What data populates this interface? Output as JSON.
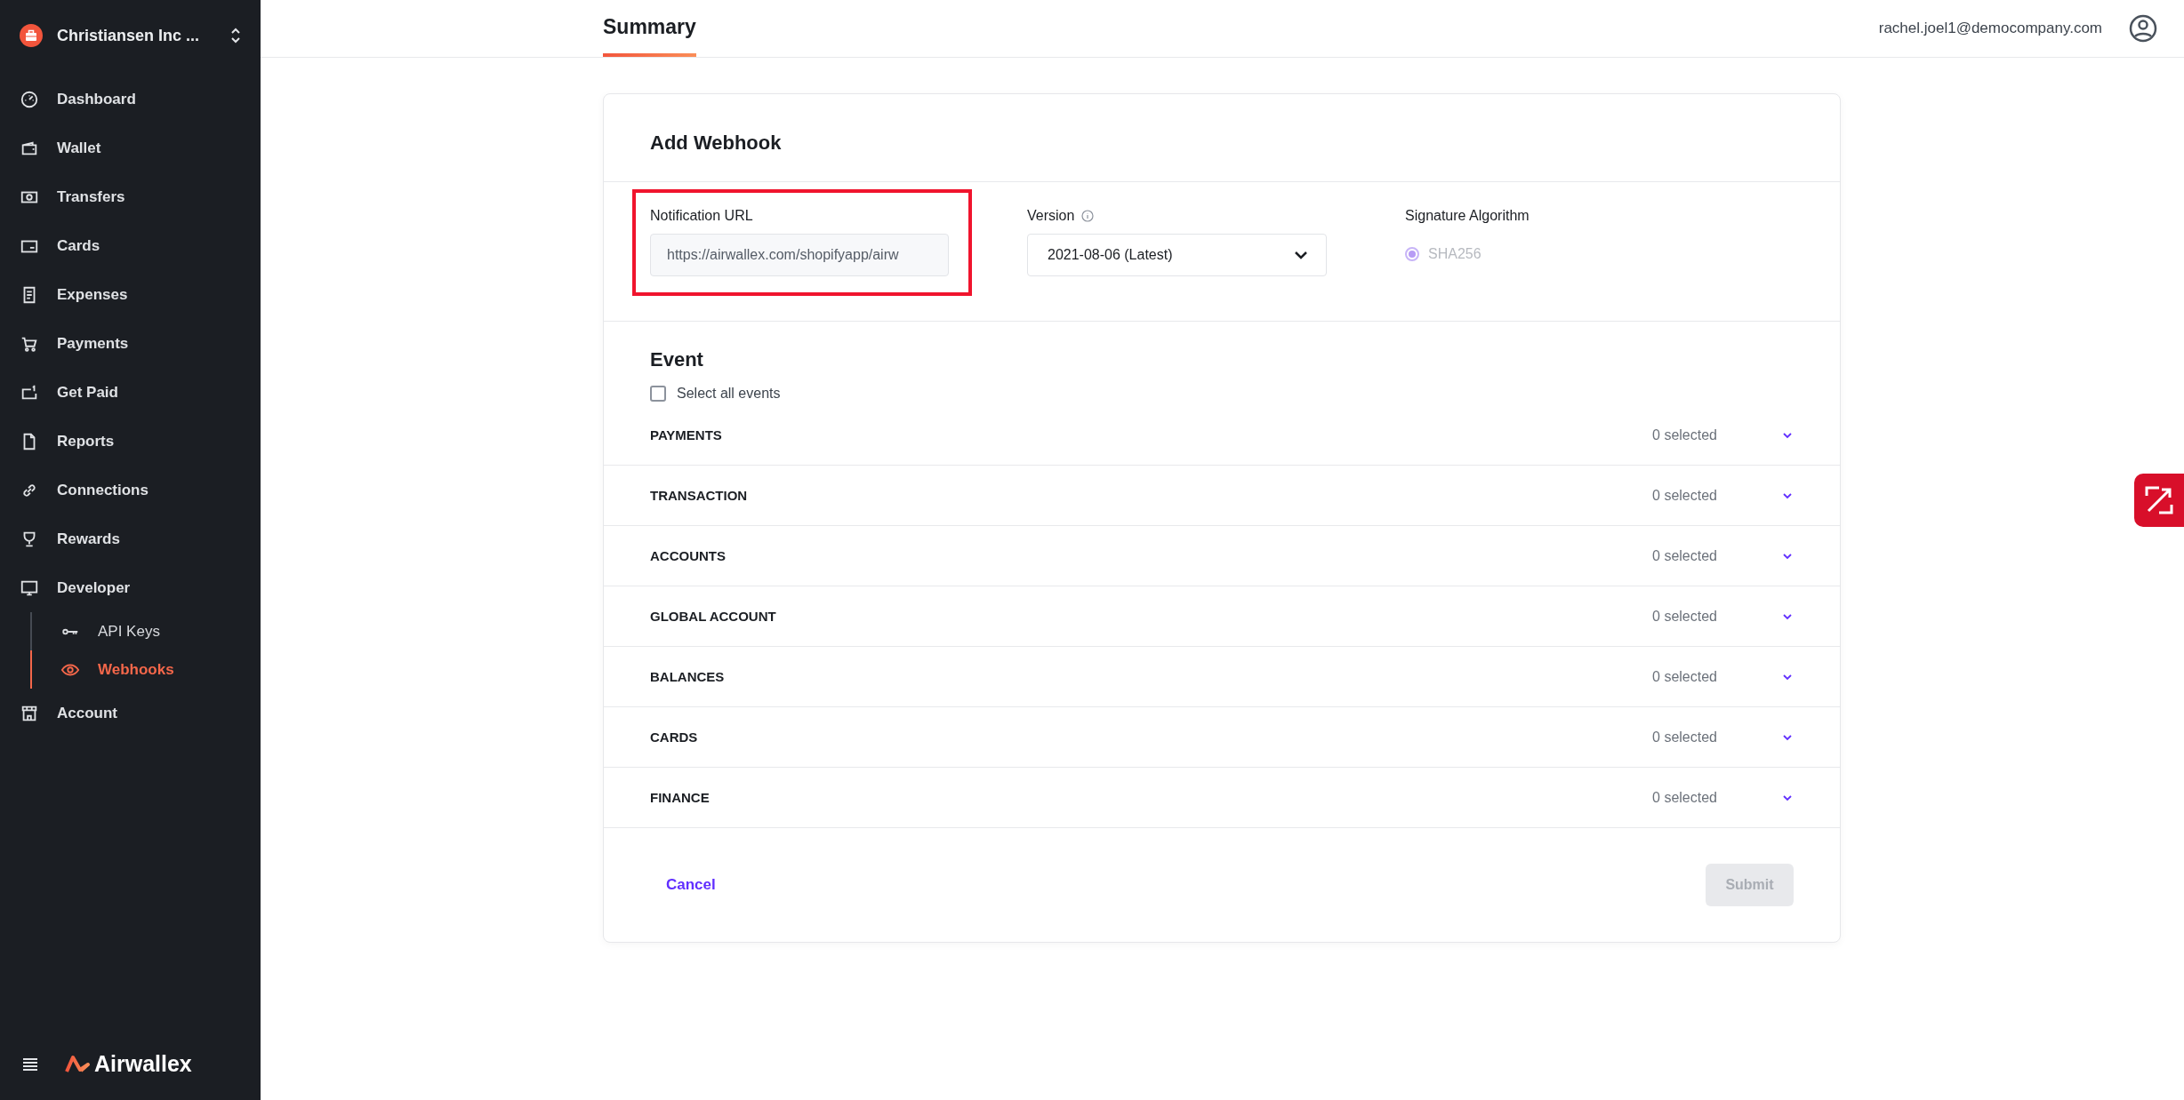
{
  "sidebar": {
    "company": "Christiansen Inc ...",
    "items": [
      {
        "label": "Dashboard",
        "selected": false
      },
      {
        "label": "Wallet",
        "selected": false
      },
      {
        "label": "Transfers",
        "selected": false
      },
      {
        "label": "Cards",
        "selected": false
      },
      {
        "label": "Expenses",
        "selected": false
      },
      {
        "label": "Payments",
        "selected": false
      },
      {
        "label": "Get Paid",
        "selected": false
      },
      {
        "label": "Reports",
        "selected": false
      },
      {
        "label": "Connections",
        "selected": false
      },
      {
        "label": "Rewards",
        "selected": false
      },
      {
        "label": "Developer",
        "selected": false,
        "children": [
          {
            "label": "API Keys",
            "selected": false
          },
          {
            "label": "Webhooks",
            "selected": true
          }
        ]
      },
      {
        "label": "Account",
        "selected": false
      }
    ],
    "logo": "Airwallex"
  },
  "header": {
    "tabs": [
      {
        "label": "Summary",
        "selected": true
      }
    ],
    "email": "rachel.joel1@democompany.com"
  },
  "form": {
    "title": "Add Webhook",
    "notification_url": {
      "label": "Notification URL",
      "value": "https://airwallex.com/shopifyapp/airw",
      "highlighted": true
    },
    "version": {
      "label": "Version",
      "value": "2021-08-06 (Latest)"
    },
    "signature": {
      "label": "Signature Algorithm",
      "options": [
        {
          "label": "SHA256",
          "checked": true,
          "disabled": true
        }
      ]
    },
    "event": {
      "title": "Event",
      "select_all": {
        "label": "Select all events",
        "checked": false
      },
      "groups": [
        {
          "label": "PAYMENTS",
          "count": "0 selected"
        },
        {
          "label": "TRANSACTION",
          "count": "0 selected"
        },
        {
          "label": "ACCOUNTS",
          "count": "0 selected"
        },
        {
          "label": "GLOBAL ACCOUNT",
          "count": "0 selected"
        },
        {
          "label": "BALANCES",
          "count": "0 selected"
        },
        {
          "label": "CARDS",
          "count": "0 selected"
        },
        {
          "label": "FINANCE",
          "count": "0 selected"
        }
      ]
    },
    "cancel": "Cancel",
    "submit": {
      "label": "Submit",
      "disabled": true
    }
  }
}
